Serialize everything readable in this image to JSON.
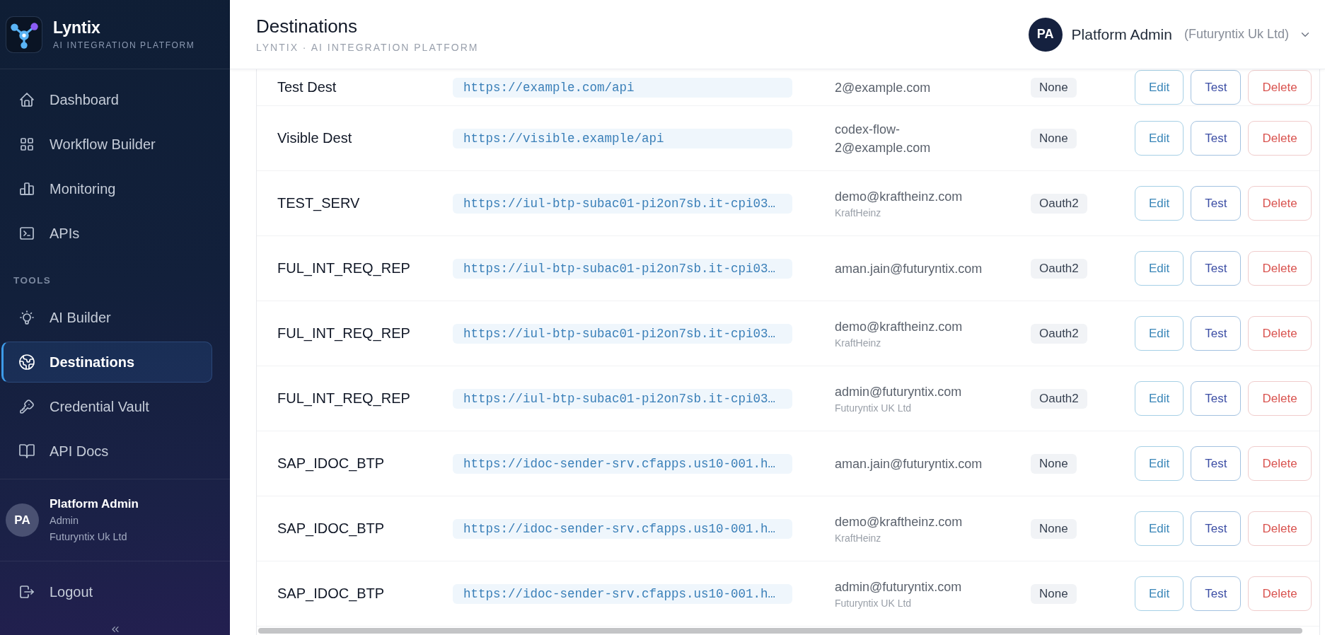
{
  "sidebar": {
    "brand": {
      "name": "Lyntix",
      "tagline": "AI INTEGRATION PLATFORM"
    },
    "main_nav": [
      {
        "label": "Dashboard",
        "selected": false
      },
      {
        "label": "Workflow Builder",
        "selected": false
      },
      {
        "label": "Monitoring",
        "selected": false
      },
      {
        "label": "APIs",
        "selected": false
      }
    ],
    "tools": {
      "heading": "TOOLS",
      "items": [
        {
          "label": "AI Builder",
          "selected": false
        },
        {
          "label": "Destinations",
          "selected": true
        },
        {
          "label": "Credential Vault",
          "selected": false
        },
        {
          "label": "API Docs",
          "selected": false
        }
      ]
    },
    "user": {
      "initials": "PA",
      "name": "Platform Admin",
      "role": "Admin",
      "organization": "Futuryntix Uk Ltd"
    },
    "logout": "Logout"
  },
  "header": {
    "title": "Destinations",
    "subtitle": "LYNTIX · AI INTEGRATION PLATFORM",
    "user": {
      "initials": "PA",
      "name": "Platform Admin",
      "organization": "(Futuryntix Uk Ltd)"
    }
  },
  "destinations": {
    "rows": [
      {
        "name": "Test Dest",
        "url": "https://example.com/api",
        "owner_lines": [
          "2@example.com"
        ],
        "auth": "None",
        "actions": [
          {
            "kind": "edit",
            "label": "Edit"
          },
          {
            "kind": "test",
            "label": "Test"
          },
          {
            "kind": "delete",
            "label": "Delete"
          }
        ]
      },
      {
        "name": "Visible Dest",
        "url": "https://visible.example/api",
        "owner_lines": [
          "codex-flow-",
          "2@example.com"
        ],
        "auth": "None",
        "actions": [
          {
            "kind": "edit",
            "label": "Edit"
          },
          {
            "kind": "test",
            "label": "Test"
          },
          {
            "kind": "delete",
            "label": "Delete"
          }
        ]
      },
      {
        "name": "TEST_SERV",
        "url": "https://iul-btp-subac01-pi2on7sb.it-cpi03…",
        "owner_lines": [
          "demo@kraftheinz.com"
        ],
        "organization": "KraftHeinz",
        "auth": "Oauth2",
        "actions": [
          {
            "kind": "edit",
            "label": "Edit"
          },
          {
            "kind": "test",
            "label": "Test"
          },
          {
            "kind": "delete",
            "label": "Delete"
          }
        ]
      },
      {
        "name": "FUL_INT_REQ_REP",
        "url": "https://iul-btp-subac01-pi2on7sb.it-cpi03…",
        "owner_lines": [
          "aman.jain@futuryntix.com"
        ],
        "auth": "Oauth2",
        "actions": [
          {
            "kind": "edit",
            "label": "Edit"
          },
          {
            "kind": "test",
            "label": "Test"
          },
          {
            "kind": "delete",
            "label": "Delete"
          }
        ]
      },
      {
        "name": "FUL_INT_REQ_REP",
        "url": "https://iul-btp-subac01-pi2on7sb.it-cpi03…",
        "owner_lines": [
          "demo@kraftheinz.com"
        ],
        "organization": "KraftHeinz",
        "auth": "Oauth2",
        "actions": [
          {
            "kind": "edit",
            "label": "Edit"
          },
          {
            "kind": "test",
            "label": "Test"
          },
          {
            "kind": "delete",
            "label": "Delete"
          }
        ]
      },
      {
        "name": "FUL_INT_REQ_REP",
        "url": "https://iul-btp-subac01-pi2on7sb.it-cpi03…",
        "owner_lines": [
          "admin@futuryntix.com"
        ],
        "organization": "Futuryntix UK Ltd",
        "auth": "Oauth2",
        "actions": [
          {
            "kind": "edit",
            "label": "Edit"
          },
          {
            "kind": "test",
            "label": "Test"
          },
          {
            "kind": "delete",
            "label": "Delete"
          }
        ]
      },
      {
        "name": "SAP_IDOC_BTP",
        "url": "https://idoc-sender-srv.cfapps.us10-001.h…",
        "owner_lines": [
          "aman.jain@futuryntix.com"
        ],
        "auth": "None",
        "actions": [
          {
            "kind": "edit",
            "label": "Edit"
          },
          {
            "kind": "test",
            "label": "Test"
          },
          {
            "kind": "delete",
            "label": "Delete"
          }
        ]
      },
      {
        "name": "SAP_IDOC_BTP",
        "url": "https://idoc-sender-srv.cfapps.us10-001.h…",
        "owner_lines": [
          "demo@kraftheinz.com"
        ],
        "organization": "KraftHeinz",
        "auth": "None",
        "actions": [
          {
            "kind": "edit",
            "label": "Edit"
          },
          {
            "kind": "test",
            "label": "Test"
          },
          {
            "kind": "delete",
            "label": "Delete"
          }
        ]
      },
      {
        "name": "SAP_IDOC_BTP",
        "url": "https://idoc-sender-srv.cfapps.us10-001.h…",
        "owner_lines": [
          "admin@futuryntix.com"
        ],
        "organization": "Futuryntix UK Ltd",
        "auth": "None",
        "actions": [
          {
            "kind": "edit",
            "label": "Edit"
          },
          {
            "kind": "test",
            "label": "Test"
          },
          {
            "kind": "delete",
            "label": "Delete"
          }
        ]
      }
    ]
  }
}
